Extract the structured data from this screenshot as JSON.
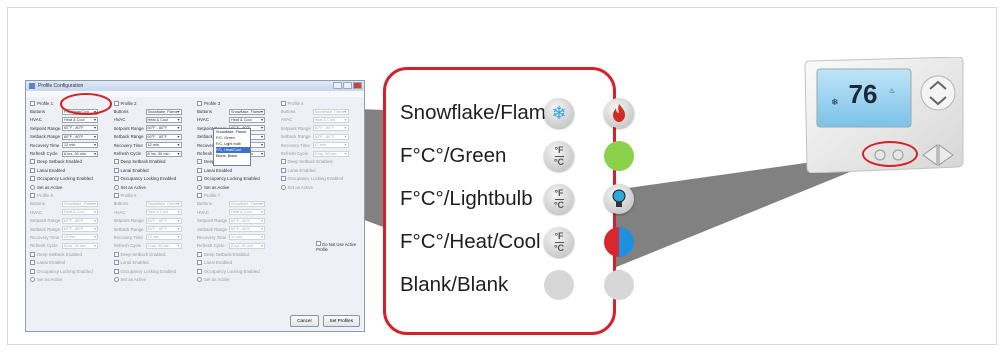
{
  "options": [
    {
      "label": "Snowflake/Flame",
      "left_icon": "snowflake-icon",
      "right_icon": "flame-icon"
    },
    {
      "label": "F°C°/Green",
      "left_icon": "fahrenheit-celsius-icon",
      "right_icon": "green-circle"
    },
    {
      "label": "F°C°/Lightbulb",
      "left_icon": "fahrenheit-celsius-icon",
      "right_icon": "lightbulb-icon"
    },
    {
      "label": "F°C°/Heat/Cool",
      "left_icon": "fahrenheit-celsius-icon",
      "right_icon": "heat-cool-icon"
    },
    {
      "label": "Blank/Blank",
      "left_icon": "blank-button",
      "right_icon": "blank-button"
    }
  ],
  "fc_symbol": {
    "top": "°F",
    "bottom": "°C"
  },
  "colors": {
    "callout_border": "#d4212a",
    "green": "#8bd14a",
    "heat": "#d8282f",
    "cool": "#1f8fe0",
    "snowflake": "#2aa8d8",
    "flame": "#d42a22"
  },
  "window": {
    "title": "Profile Configuration",
    "profiles": [
      {
        "name": "Profile 1",
        "buttons": "F/C, Heat/Cool",
        "hvac": "Heat & Cool",
        "setpoint": "60°F - 80°F",
        "setback": "60°F - 80°F",
        "recovery": "12 min",
        "refresh": "8 hrs, 30 min",
        "enabled": true
      },
      {
        "name": "Profile 2",
        "buttons": "Snowflake, Flame",
        "hvac": "Heat & Cool",
        "setpoint": "60°F - 80°F",
        "setback": "60°F - 80°F",
        "recovery": "12 min",
        "refresh": "8 hrs, 30 min",
        "enabled": true
      },
      {
        "name": "Profile 3",
        "buttons": "Snowflake, Flame",
        "hvac": "Heat & Cool",
        "setpoint": "60°F - 80°F",
        "setback": "60°F - 80°F",
        "recovery": "12 min",
        "refresh": "8 hrs, 30 min",
        "enabled": true
      },
      {
        "name": "Profile 4",
        "buttons": "Snowflake, Flame",
        "hvac": "Heat & Cool",
        "setpoint": "60°F - 80°F",
        "setback": "60°F - 80°F",
        "recovery": "12 min",
        "refresh": "8 hrs, 30 min",
        "enabled": false
      },
      {
        "name": "Profile 5",
        "buttons": "Snowflake, Flame",
        "hvac": "Heat & Cool",
        "setpoint": "60°F - 80°F",
        "setback": "60°F - 80°F",
        "recovery": "12 min",
        "refresh": "8 hrs, 30 min",
        "enabled": false
      },
      {
        "name": "Profile 6",
        "buttons": "Snowflake, Flame",
        "hvac": "Heat & Cool",
        "setpoint": "60°F - 80°F",
        "setback": "60°F - 80°F",
        "recovery": "12 min",
        "refresh": "8 hrs, 30 min",
        "enabled": false
      },
      {
        "name": "Profile 7",
        "buttons": "Snowflake, Flame",
        "hvac": "Heat & Cool",
        "setpoint": "60°F - 80°F",
        "setback": "60°F - 80°F",
        "recovery": "12 min",
        "refresh": "8 hrs, 30 min",
        "enabled": false
      }
    ],
    "field_labels": {
      "buttons": "Buttons",
      "hvac": "HVAC",
      "setpoint": "Setpoint Range",
      "setback": "Setback Range",
      "recovery": "Recovery Time",
      "refresh": "Refresh Cycle"
    },
    "check_labels": [
      "Deep Setback Enabled",
      "Lanai Enabled",
      "Occupancy Locking Enabled",
      "Set as Active"
    ],
    "dropdown_options": [
      "Snowflake, Flame",
      "F/C, Green",
      "F/C, Light bulb",
      "F/C, Heat/Cool",
      "Blank, Blank"
    ],
    "dropdown_selected_index": 3,
    "no_profile_note": "Do Not Use Active Profile",
    "cancel_label": "Cancel",
    "set_profiles_label": "Set Profiles"
  },
  "thermostat": {
    "temperature": "76"
  }
}
